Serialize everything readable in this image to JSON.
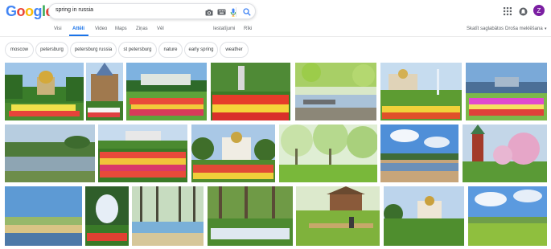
{
  "logo": {
    "letters": [
      "G",
      "o",
      "o",
      "g",
      "l",
      "e"
    ],
    "colors": [
      "#4285f4",
      "#ea4335",
      "#fbbc05",
      "#4285f4",
      "#34a853",
      "#ea4335"
    ]
  },
  "search": {
    "query": "spring in russia"
  },
  "header": {
    "avatar_initial": "Z"
  },
  "tabs": {
    "items": [
      "Visi",
      "Attēli",
      "Video",
      "Maps",
      "Ziņas",
      "Vēl",
      "Iestatījumi",
      "Rīki"
    ],
    "active": "Attēli",
    "right": [
      "Skatīt saglabātos",
      "Droša meklēšana"
    ]
  },
  "chips": [
    "moscow",
    "petersburg",
    "petersburg russia",
    "st petersburg",
    "nature",
    "early spring",
    "weather"
  ],
  "images": [
    {
      "alt": "spring in russia 1"
    },
    {
      "alt": "spring in russia 2"
    },
    {
      "alt": "spring in russia 3"
    },
    {
      "alt": "spring in russia 4"
    },
    {
      "alt": "spring in russia 5"
    },
    {
      "alt": "spring in russia 6"
    },
    {
      "alt": "spring in russia 7"
    },
    {
      "alt": "spring in russia 8"
    },
    {
      "alt": "spring in russia 9"
    },
    {
      "alt": "spring in russia 10"
    },
    {
      "alt": "spring in russia 11"
    },
    {
      "alt": "spring in russia 12"
    },
    {
      "alt": "spring in russia 13"
    },
    {
      "alt": "spring in russia 14"
    },
    {
      "alt": "spring in russia 15"
    },
    {
      "alt": "spring in russia 16"
    },
    {
      "alt": "spring in russia 17"
    },
    {
      "alt": "spring in russia 18"
    },
    {
      "alt": "spring in russia 19"
    },
    {
      "alt": "spring in russia 20"
    },
    {
      "alt": "spring in russia 21"
    }
  ],
  "colors": {
    "accent": "#1a73e8",
    "avatar": "#7b1fa2"
  }
}
